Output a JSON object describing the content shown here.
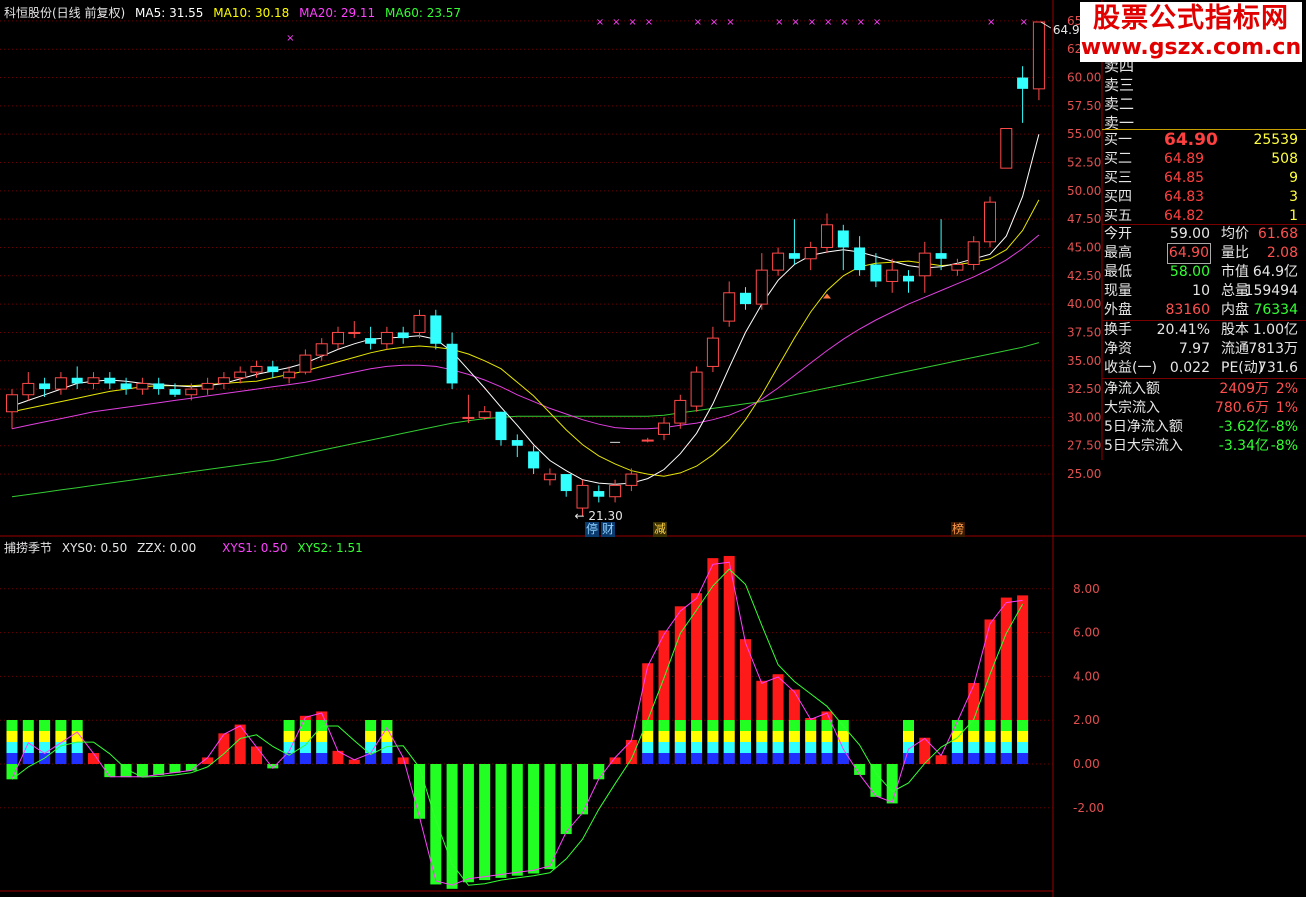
{
  "title_bar": {
    "stock_name": "科恒股份(日线 前复权)",
    "ma5": "MA5: 31.55",
    "ma10": "MA10: 30.18",
    "ma20": "MA20: 29.11",
    "ma60": "MA60: 23.57"
  },
  "indicator_bar": {
    "name": "捕捞季节",
    "xys0": "XYS0: 0.50",
    "zzx": "ZZX: 0.00",
    "xys1": "XYS1: 0.50",
    "xys2": "XYS2: 1.51"
  },
  "price_axis_labels": [
    "65.00",
    "62.50",
    "60.00",
    "57.50",
    "55.00",
    "52.50",
    "50.00",
    "47.50",
    "45.00",
    "42.50",
    "40.00",
    "37.50",
    "35.00",
    "32.50",
    "30.00",
    "27.50",
    "25.00"
  ],
  "indicator_axis_labels": [
    "8.00",
    "6.00",
    "4.00",
    "2.00",
    "0.00",
    "-2.00"
  ],
  "annotations": {
    "high_label": "64.90",
    "low_label": "21.30"
  },
  "event_badges": [
    {
      "text": "停",
      "color": "#3fa0ff"
    },
    {
      "text": "财",
      "color": "#3fa0ff"
    },
    {
      "text": "减",
      "color": "#ffd24a"
    },
    {
      "text": "榜",
      "color": "#ff8a3a"
    }
  ],
  "watermark": {
    "line1": "股票公式指标网",
    "line2": "www.gszx.com.cn"
  },
  "order_book": {
    "sell": [
      "卖四",
      "卖三",
      "卖二",
      "卖一"
    ],
    "buy": [
      {
        "label": "买一",
        "price": "64.90",
        "vol": "25539"
      },
      {
        "label": "买二",
        "price": "64.89",
        "vol": "508"
      },
      {
        "label": "买三",
        "price": "64.85",
        "vol": "9"
      },
      {
        "label": "买四",
        "price": "64.83",
        "vol": "3"
      },
      {
        "label": "买五",
        "price": "64.82",
        "vol": "1"
      }
    ]
  },
  "quote_table": [
    {
      "l1": "今开",
      "v1": "59.00",
      "c1": "#e6e6e6",
      "l2": "均价",
      "v2": "61.68",
      "c2": "#ff5050"
    },
    {
      "l1": "最高",
      "v1": "64.90",
      "c1": "#ff5050",
      "l2": "量比",
      "v2": "2.08",
      "c2": "#ff5050"
    },
    {
      "l1": "最低",
      "v1": "58.00",
      "c1": "#33ff33",
      "l2": "市值",
      "v2": "64.9亿",
      "c2": "#e6e6e6"
    },
    {
      "l1": "现量",
      "v1": "10",
      "c1": "#e6e6e6",
      "l2": "总量",
      "v2": "159494",
      "c2": "#e6e6e6"
    },
    {
      "l1": "外盘",
      "v1": "83160",
      "c1": "#ff5050",
      "l2": "内盘",
      "v2": "76334",
      "c2": "#33ff33"
    }
  ],
  "fund_table": [
    {
      "l1": "换手",
      "v1": "20.41%",
      "l2": "股本",
      "v2": "1.00亿"
    },
    {
      "l1": "净资",
      "v1": "7.97",
      "l2": "流通",
      "v2": "7813万"
    },
    {
      "l1": "收益(一)",
      "v1": "0.022",
      "l2": "PE(动)",
      "v2": "731.6"
    }
  ],
  "flow_table": [
    {
      "l": "净流入额",
      "v": "2409万",
      "p": "2%",
      "c": "#ff5050"
    },
    {
      "l": "大宗流入",
      "v": "780.6万",
      "p": "1%",
      "c": "#ff5050"
    },
    {
      "l": "5日净流入额",
      "v": "-3.62亿",
      "p": "-8%",
      "c": "#33ff33"
    },
    {
      "l": "5日大宗流入",
      "v": "-3.34亿",
      "p": "-8%",
      "c": "#33ff33"
    }
  ],
  "chart_data": {
    "type": "candlestick",
    "candles": [
      [
        30.5,
        32.0,
        29.0,
        32.5
      ],
      [
        32.0,
        33.0,
        31.5,
        34.0
      ],
      [
        33.0,
        32.5,
        31.8,
        33.5
      ],
      [
        32.5,
        33.5,
        32.0,
        34.0
      ],
      [
        33.5,
        33.0,
        32.5,
        34.5
      ],
      [
        33.0,
        33.5,
        32.5,
        34.0
      ],
      [
        33.5,
        33.0,
        32.5,
        34.0
      ],
      [
        33.0,
        32.5,
        32.0,
        33.5
      ],
      [
        32.5,
        33.0,
        32.0,
        33.5
      ],
      [
        33.0,
        32.5,
        32.0,
        33.5
      ],
      [
        32.5,
        32.0,
        31.8,
        33.0
      ],
      [
        32.0,
        32.5,
        31.5,
        33.0
      ],
      [
        32.5,
        33.0,
        32.0,
        33.5
      ],
      [
        33.0,
        33.5,
        32.5,
        34.0
      ],
      [
        33.5,
        34.0,
        33.0,
        34.5
      ],
      [
        34.0,
        34.5,
        33.5,
        35.0
      ],
      [
        34.5,
        34.0,
        33.5,
        35.0
      ],
      [
        33.5,
        34.0,
        33.0,
        34.5
      ],
      [
        34.0,
        35.5,
        33.8,
        36.0
      ],
      [
        35.5,
        36.5,
        35.0,
        37.0
      ],
      [
        36.5,
        37.5,
        36.0,
        38.0
      ],
      [
        37.5,
        37.5,
        37.0,
        38.5
      ],
      [
        37.0,
        36.5,
        36.0,
        38.0
      ],
      [
        36.5,
        37.5,
        36.0,
        38.0
      ],
      [
        37.5,
        37.0,
        36.5,
        38.0
      ],
      [
        37.5,
        39.0,
        37.0,
        39.5
      ],
      [
        39.0,
        36.5,
        36.0,
        39.5
      ],
      [
        36.5,
        33.0,
        32.5,
        37.5
      ],
      [
        30.0,
        30.0,
        29.5,
        32.0
      ],
      [
        30.0,
        30.5,
        29.8,
        31.0
      ],
      [
        30.5,
        28.0,
        27.5,
        30.5
      ],
      [
        28.0,
        27.5,
        26.5,
        28.5
      ],
      [
        27.0,
        25.5,
        25.0,
        27.5
      ],
      [
        24.5,
        25.0,
        24.0,
        25.5
      ],
      [
        25.0,
        23.5,
        23.0,
        25.0
      ],
      [
        22.0,
        24.0,
        21.3,
        24.5
      ],
      [
        23.5,
        23.0,
        22.5,
        24.0
      ],
      [
        23.0,
        24.0,
        22.5,
        24.5
      ],
      [
        24.0,
        25.0,
        23.5,
        25.5
      ],
      [
        28.0,
        28.0,
        27.8,
        28.2
      ],
      [
        28.5,
        29.5,
        28.0,
        30.0
      ],
      [
        29.5,
        31.5,
        29.0,
        32.0
      ],
      [
        31.0,
        34.0,
        30.5,
        34.5
      ],
      [
        34.5,
        37.0,
        34.0,
        38.0
      ],
      [
        38.5,
        41.0,
        38.0,
        42.0
      ],
      [
        41.0,
        40.0,
        39.5,
        41.5
      ],
      [
        40.0,
        43.0,
        39.5,
        44.5
      ],
      [
        43.0,
        44.5,
        42.5,
        45.0
      ],
      [
        44.5,
        44.0,
        43.5,
        47.5
      ],
      [
        44.0,
        45.0,
        43.0,
        45.5
      ],
      [
        45.0,
        47.0,
        44.5,
        48.0
      ],
      [
        46.5,
        45.0,
        43.0,
        47.0
      ],
      [
        45.0,
        43.0,
        42.5,
        46.0
      ],
      [
        43.5,
        42.0,
        41.5,
        44.5
      ],
      [
        42.0,
        43.0,
        41.0,
        44.0
      ],
      [
        42.5,
        42.0,
        41.0,
        43.0
      ],
      [
        42.5,
        44.5,
        41.0,
        45.5
      ],
      [
        44.5,
        44.0,
        43.0,
        47.5
      ],
      [
        43.0,
        43.5,
        42.5,
        44.0
      ],
      [
        43.5,
        45.5,
        43.0,
        46.0
      ],
      [
        45.5,
        49.0,
        45.0,
        49.5
      ],
      [
        52.0,
        55.5,
        52.0,
        55.5
      ],
      [
        60.0,
        59.0,
        56.0,
        61.0
      ],
      [
        59.0,
        64.9,
        58.0,
        64.9
      ]
    ],
    "ma5": [
      31.0,
      31.5,
      32.0,
      32.5,
      33.0,
      33.2,
      33.3,
      33.2,
      33.0,
      32.9,
      32.8,
      32.7,
      32.8,
      33.0,
      33.4,
      33.8,
      34.1,
      34.4,
      34.8,
      35.4,
      36.0,
      36.5,
      36.9,
      37.0,
      37.1,
      37.2,
      36.9,
      35.8,
      34.2,
      32.6,
      30.9,
      29.3,
      27.6,
      26.2,
      25.3,
      24.5,
      24.2,
      24.1,
      24.2,
      24.6,
      25.4,
      26.8,
      28.6,
      31.2,
      34.4,
      37.5,
      40.0,
      42.1,
      43.5,
      44.3,
      44.6,
      44.8,
      44.6,
      44.2,
      43.8,
      43.4,
      43.2,
      43.3,
      43.6,
      44.0,
      44.4,
      46.0,
      49.5,
      55.0
    ],
    "ma10": [
      30.5,
      30.8,
      31.1,
      31.4,
      31.7,
      32.0,
      32.3,
      32.5,
      32.7,
      32.8,
      32.8,
      32.8,
      32.9,
      33.0,
      33.1,
      33.2,
      33.5,
      33.8,
      34.1,
      34.5,
      34.9,
      35.3,
      35.7,
      36.0,
      36.2,
      36.3,
      36.2,
      36.0,
      35.6,
      35.0,
      34.3,
      33.1,
      31.9,
      30.4,
      28.9,
      27.6,
      26.6,
      25.9,
      25.3,
      25.0,
      24.8,
      25.1,
      25.7,
      26.7,
      28.0,
      29.8,
      32.0,
      34.5,
      37.0,
      39.3,
      41.2,
      42.5,
      43.3,
      43.6,
      43.7,
      43.8,
      43.6,
      43.4,
      43.5,
      43.7,
      44.0,
      44.8,
      46.5,
      49.2
    ],
    "ma20": [
      29.0,
      29.3,
      29.6,
      29.9,
      30.2,
      30.5,
      30.7,
      30.9,
      31.1,
      31.3,
      31.5,
      31.7,
      31.9,
      32.1,
      32.3,
      32.5,
      32.7,
      32.9,
      33.1,
      33.4,
      33.7,
      34.0,
      34.3,
      34.5,
      34.6,
      34.6,
      34.5,
      34.2,
      33.8,
      33.3,
      32.7,
      32.0,
      31.4,
      30.8,
      30.3,
      29.8,
      29.4,
      29.1,
      29.0,
      29.0,
      29.1,
      29.3,
      29.5,
      29.8,
      30.2,
      30.8,
      31.6,
      32.6,
      33.7,
      34.8,
      35.9,
      36.9,
      37.8,
      38.6,
      39.3,
      40.0,
      40.6,
      41.2,
      41.8,
      42.4,
      43.1,
      43.9,
      44.9,
      46.1
    ],
    "ma60": [
      23.0,
      23.2,
      23.4,
      23.6,
      23.8,
      24.0,
      24.2,
      24.4,
      24.6,
      24.8,
      25.0,
      25.2,
      25.4,
      25.6,
      25.8,
      26.0,
      26.2,
      26.5,
      26.8,
      27.1,
      27.4,
      27.7,
      28.0,
      28.3,
      28.6,
      28.9,
      29.2,
      29.5,
      29.7,
      29.9,
      30.0,
      30.1,
      30.1,
      30.1,
      30.1,
      30.1,
      30.1,
      30.1,
      30.1,
      30.1,
      30.2,
      30.4,
      30.6,
      30.8,
      31.0,
      31.2,
      31.4,
      31.7,
      32.0,
      32.3,
      32.6,
      32.9,
      33.2,
      33.5,
      33.8,
      34.1,
      34.4,
      34.7,
      35.0,
      35.3,
      35.6,
      35.9,
      36.2,
      36.6
    ],
    "indicator_bars": [
      -0.7,
      1.0,
      0.5,
      1.0,
      1.5,
      0.5,
      -0.6,
      -0.6,
      -0.6,
      -0.5,
      -0.4,
      -0.3,
      0.3,
      1.4,
      1.8,
      0.8,
      -0.2,
      0.6,
      2.2,
      2.4,
      0.6,
      0.2,
      0.5,
      1.7,
      0.3,
      -2.5,
      -5.5,
      -5.7,
      -5.4,
      -5.3,
      -5.2,
      -5.1,
      -5.0,
      -4.8,
      -3.2,
      -2.3,
      -0.7,
      0.3,
      1.1,
      4.6,
      6.1,
      7.2,
      7.8,
      9.4,
      9.5,
      5.7,
      3.8,
      4.1,
      3.4,
      2.1,
      2.4,
      0.7,
      -0.5,
      -1.5,
      -1.8,
      0.7,
      1.2,
      0.4,
      2.0,
      3.7,
      6.6,
      7.6,
      7.7
    ],
    "flag_bars": [
      1,
      1,
      1,
      1,
      1,
      0,
      0,
      0,
      0,
      0,
      0,
      0,
      0,
      0,
      0,
      0,
      0,
      1,
      1,
      1,
      0,
      0,
      1,
      1,
      0,
      0,
      0,
      0,
      0,
      0,
      0,
      0,
      0,
      0,
      0,
      0,
      0,
      0,
      0,
      1,
      1,
      1,
      1,
      1,
      1,
      1,
      1,
      1,
      1,
      1,
      1,
      1,
      0,
      0,
      0,
      1,
      0,
      0,
      1,
      1,
      1,
      1,
      1
    ]
  }
}
